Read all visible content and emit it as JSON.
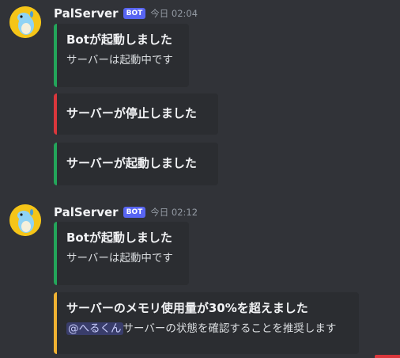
{
  "messages": [
    {
      "username": "PalServer",
      "badge": "BOT",
      "time": "今日 02:04",
      "embeds": [
        {
          "title": "Botが起動しました",
          "description": "サーバーは起動中です",
          "color": "#23a55a"
        },
        {
          "title": "サーバーが停止しました",
          "description": "",
          "color": "#da373c"
        },
        {
          "title": "サーバーが起動しました",
          "description": "",
          "color": "#23a55a"
        }
      ]
    },
    {
      "username": "PalServer",
      "badge": "BOT",
      "time": "今日 02:12",
      "embeds": [
        {
          "title": "Botが起動しました",
          "description": "サーバーは起動中です",
          "color": "#23a55a"
        },
        {
          "title": "サーバーのメモリ使用量が30%を超えました",
          "mention": "@へるくん",
          "description": "サーバーの状態を確認することを推奨します",
          "color": "#f0b232"
        }
      ]
    }
  ],
  "colors": {
    "background": "#313338",
    "embed_bg": "#2b2d31",
    "accent": "#5865f2"
  }
}
